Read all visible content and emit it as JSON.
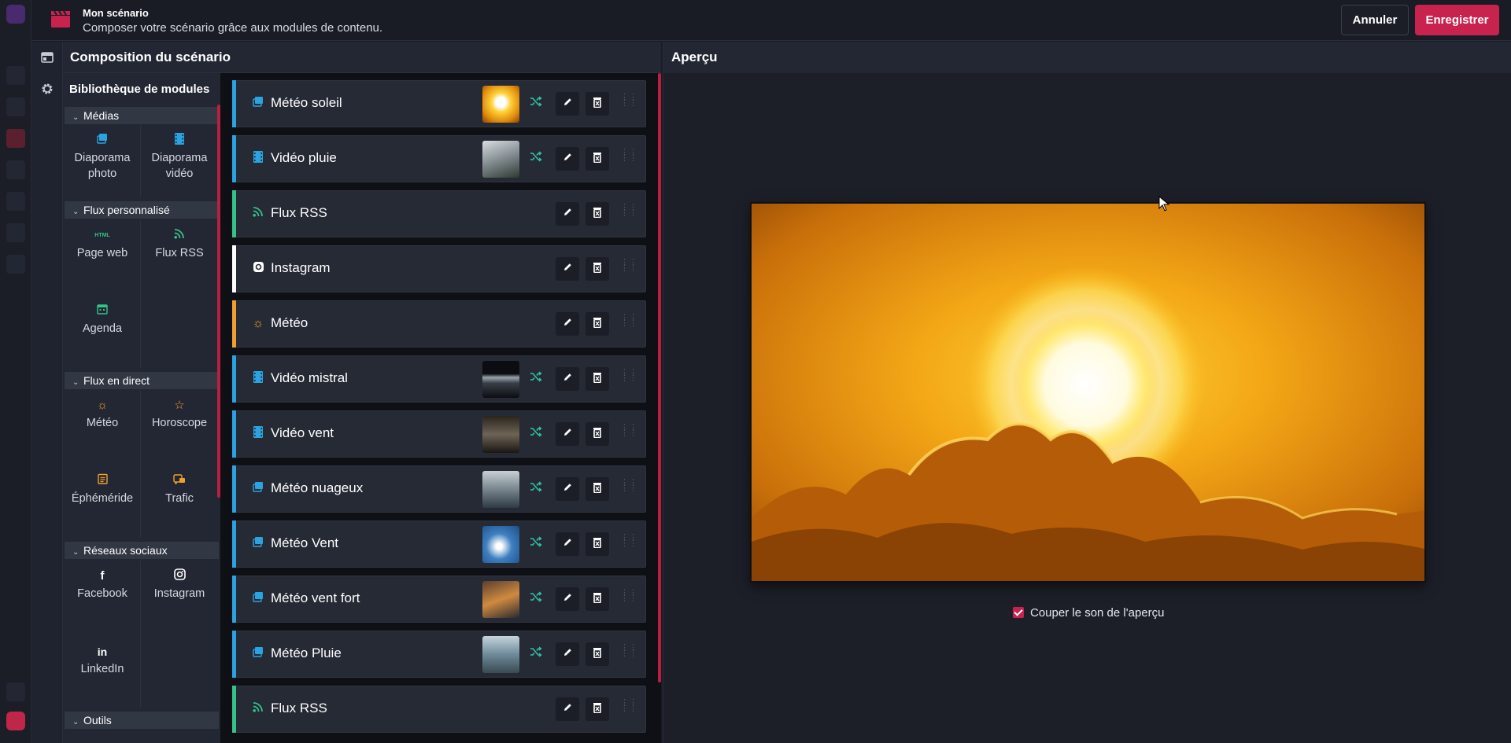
{
  "header": {
    "title": "Mon scénario",
    "subtitle": "Composer votre scénario grâce aux modules de contenu.",
    "cancel_label": "Annuler",
    "save_label": "Enregistrer",
    "accent": "#c8234f"
  },
  "composition": {
    "title": "Composition du scénario"
  },
  "library": {
    "title": "Bibliothèque de modules",
    "categories": [
      {
        "label": "Médias",
        "items": [
          {
            "label": "Diaporama photo",
            "icon": "image-icon",
            "color": "#2ba3e0"
          },
          {
            "label": "Diaporama vidéo",
            "icon": "film-icon",
            "color": "#2ba3e0"
          }
        ]
      },
      {
        "label": "Flux personnalisé",
        "items": [
          {
            "label": "Page web",
            "icon": "html-icon",
            "color": "#35c28a"
          },
          {
            "label": "Flux RSS",
            "icon": "rss-icon",
            "color": "#35c28a"
          },
          {
            "label": "Agenda",
            "icon": "calendar-icon",
            "color": "#35c28a"
          }
        ]
      },
      {
        "label": "Flux en direct",
        "items": [
          {
            "label": "Météo",
            "icon": "sun-icon",
            "color": "#f0a030"
          },
          {
            "label": "Horoscope",
            "icon": "star-icon",
            "color": "#f0a030"
          },
          {
            "label": "Éphéméride",
            "icon": "calendar-list-icon",
            "color": "#f0a030"
          },
          {
            "label": "Trafic",
            "icon": "traffic-icon",
            "color": "#f0a030"
          }
        ]
      },
      {
        "label": "Réseaux sociaux",
        "items": [
          {
            "label": "Facebook",
            "icon": "facebook-icon",
            "color": "#ffffff"
          },
          {
            "label": "Instagram",
            "icon": "instagram-icon",
            "color": "#ffffff"
          },
          {
            "label": "LinkedIn",
            "icon": "linkedin-icon",
            "color": "#ffffff"
          }
        ]
      },
      {
        "label": "Outils",
        "items": []
      }
    ]
  },
  "scenario": {
    "items": [
      {
        "label": "Météo soleil",
        "type": "photo",
        "icon": "image-icon",
        "color": "#2ba3e0",
        "has_thumb": true,
        "shuffle": true
      },
      {
        "label": "Vidéo pluie",
        "type": "video",
        "icon": "film-icon",
        "color": "#2ba3e0",
        "has_thumb": true,
        "shuffle": true
      },
      {
        "label": "Flux RSS",
        "type": "rss",
        "icon": "rss-icon",
        "color": "#35c28a",
        "has_thumb": false,
        "shuffle": false
      },
      {
        "label": "Instagram",
        "type": "instagram",
        "icon": "instagram-icon",
        "color": "#ffffff",
        "has_thumb": false,
        "shuffle": false
      },
      {
        "label": "Météo",
        "type": "weather",
        "icon": "sun-icon",
        "color": "#f0a030",
        "has_thumb": false,
        "shuffle": false
      },
      {
        "label": "Vidéo mistral",
        "type": "video",
        "icon": "film-icon",
        "color": "#2ba3e0",
        "has_thumb": true,
        "shuffle": true
      },
      {
        "label": "Vidéo vent",
        "type": "video",
        "icon": "film-icon",
        "color": "#2ba3e0",
        "has_thumb": true,
        "shuffle": true
      },
      {
        "label": "Météo nuageux",
        "type": "photo",
        "icon": "image-icon",
        "color": "#2ba3e0",
        "has_thumb": true,
        "shuffle": true
      },
      {
        "label": "Météo Vent",
        "type": "photo",
        "icon": "image-icon",
        "color": "#2ba3e0",
        "has_thumb": true,
        "shuffle": true
      },
      {
        "label": "Météo vent fort",
        "type": "photo",
        "icon": "image-icon",
        "color": "#2ba3e0",
        "has_thumb": true,
        "shuffle": true
      },
      {
        "label": "Météo Pluie",
        "type": "photo",
        "icon": "image-icon",
        "color": "#2ba3e0",
        "has_thumb": true,
        "shuffle": true
      },
      {
        "label": "Flux RSS",
        "type": "rss",
        "icon": "rss-icon",
        "color": "#35c28a",
        "has_thumb": false,
        "shuffle": false
      }
    ]
  },
  "preview": {
    "title": "Aperçu",
    "mute_label": "Couper le son de l'aperçu",
    "mute_checked": true
  }
}
